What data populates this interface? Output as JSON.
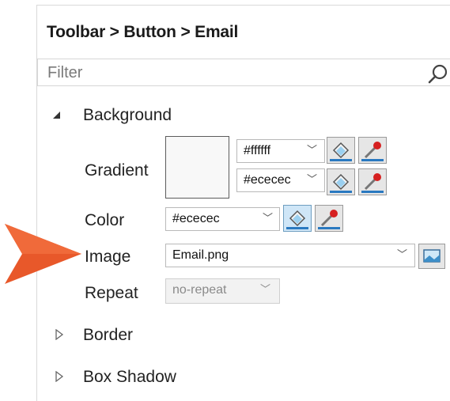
{
  "panel": {
    "breadcrumb": "Toolbar > Button > Email",
    "filter_placeholder": "Filter"
  },
  "background_section": {
    "label": "Background",
    "gradient": {
      "label": "Gradient",
      "color1": "#ffffff",
      "color2": "#ececec"
    },
    "color": {
      "label": "Color",
      "value": "#ececec"
    },
    "image": {
      "label": "Image",
      "value": "Email.png"
    },
    "repeat": {
      "label": "Repeat",
      "value": "no-repeat"
    }
  },
  "sections": {
    "border": "Border",
    "box_shadow": "Box Shadow"
  },
  "colors": {
    "accent_arrow": "#e8582a",
    "selection_blue": "#2a79c0"
  }
}
